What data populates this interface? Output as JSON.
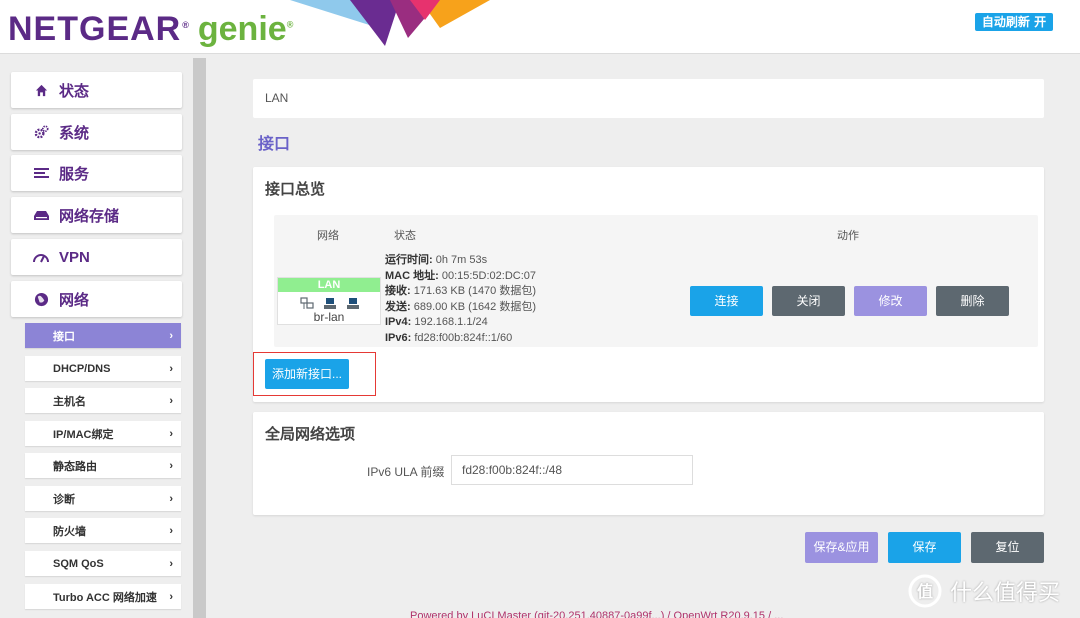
{
  "header": {
    "brand": "NETGEAR",
    "product": "genie",
    "auto_refresh": "自动刷新 开"
  },
  "sidebar": {
    "menu": [
      {
        "label": "状态",
        "icon": "home-icon"
      },
      {
        "label": "系统",
        "icon": "gears-icon"
      },
      {
        "label": "服务",
        "icon": "list-icon"
      },
      {
        "label": "网络存储",
        "icon": "drive-icon"
      },
      {
        "label": "VPN",
        "icon": "gauge-icon"
      },
      {
        "label": "网络",
        "icon": "globe-icon"
      }
    ],
    "submenu": [
      {
        "label": "接口",
        "active": true
      },
      {
        "label": "DHCP/DNS"
      },
      {
        "label": "主机名"
      },
      {
        "label": "IP/MAC绑定"
      },
      {
        "label": "静态路由"
      },
      {
        "label": "诊断"
      },
      {
        "label": "防火墙"
      },
      {
        "label": "SQM QoS"
      },
      {
        "label": "Turbo ACC 网络加速"
      }
    ]
  },
  "breadcrumb": "LAN",
  "page_title": "接口",
  "overview": {
    "title": "接口总览",
    "col_network": "网络",
    "col_status": "状态",
    "col_actions": "动作",
    "lan": {
      "name": "LAN",
      "device": "br-lan",
      "badge_color": "#90ee90",
      "status": [
        {
          "key": "运行时间:",
          "value": " 0h 7m 53s"
        },
        {
          "key": "MAC 地址:",
          "value": " 00:15:5D:02:DC:07"
        },
        {
          "key": "接收:",
          "value": " 171.63 KB (1470 数据包)"
        },
        {
          "key": "发送:",
          "value": " 689.00 KB (1642 数据包)"
        },
        {
          "key": "IPv4:",
          "value": " 192.168.1.1/24"
        },
        {
          "key": "IPv6:",
          "value": " fd28:f00b:824f::1/60"
        }
      ]
    },
    "buttons": {
      "connect": "连接",
      "stop": "关闭",
      "edit": "修改",
      "delete": "删除"
    },
    "add_interface": "添加新接口..."
  },
  "global": {
    "title": "全局网络选项",
    "ula_label": "IPv6 ULA 前缀",
    "ula_value": "fd28:f00b:824f::/48"
  },
  "actions": {
    "save_apply": "保存&应用",
    "save": "保存",
    "reset": "复位"
  },
  "footer": "Powered by LuCI Master (git-20.251.40887-0a99f...) / OpenWrt R20.9.15 / ...",
  "watermark": "什么值得买",
  "colors": {
    "brand_purple": "#5b2a86",
    "accent_blue": "#1aa3e8",
    "accent_purple": "#9b92e0",
    "dark_gray": "#5d6870"
  }
}
